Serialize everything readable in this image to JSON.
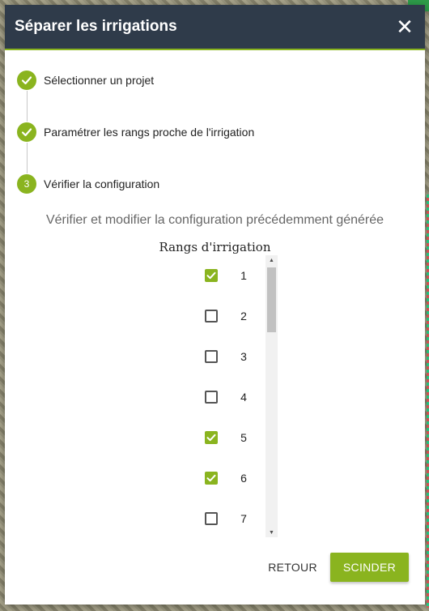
{
  "dialog": {
    "title": "Séparer les irrigations",
    "close_label": "✕"
  },
  "stepper": {
    "steps": [
      {
        "label": "Sélectionner un projet",
        "state": "completed",
        "icon": "check-icon"
      },
      {
        "label": "Paramétrer les rangs proche de l'irrigation",
        "state": "completed",
        "icon": "check-icon"
      },
      {
        "label": "Vérifier la configuration",
        "state": "active",
        "number": "3"
      }
    ]
  },
  "config": {
    "description": "Vérifier et modifier la configuration précédemment générée",
    "column_header": "Rangs d'irrigation",
    "rows": [
      {
        "number": "1",
        "checked": true
      },
      {
        "number": "2",
        "checked": false
      },
      {
        "number": "3",
        "checked": false
      },
      {
        "number": "4",
        "checked": false
      },
      {
        "number": "5",
        "checked": true
      },
      {
        "number": "6",
        "checked": true
      },
      {
        "number": "7",
        "checked": false
      }
    ]
  },
  "footer": {
    "back_label": "RETOUR",
    "submit_label": "SCINDER"
  },
  "colors": {
    "accent": "#8ab41f",
    "header_bg": "#2f3b4a"
  }
}
